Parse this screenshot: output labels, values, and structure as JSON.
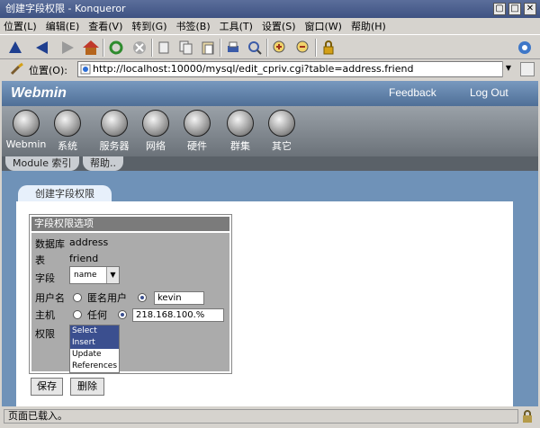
{
  "window": {
    "title": "创建字段权限 - Konqueror",
    "controls": [
      "▢",
      "□",
      "✕"
    ]
  },
  "menubar": [
    "位置(L)",
    "编辑(E)",
    "查看(V)",
    "转到(G)",
    "书签(B)",
    "工具(T)",
    "设置(S)",
    "窗口(W)",
    "帮助(H)"
  ],
  "location": {
    "label": "位置(O):",
    "url": "http://localhost:10000/mysql/edit_cpriv.cgi?table=address.friend"
  },
  "webmin": {
    "logo": "Webmin",
    "feedback": "Feedback",
    "logout": "Log Out",
    "nav": [
      "Webmin",
      "系统",
      "服务器",
      "网络",
      "硬件",
      "群集",
      "其它"
    ],
    "subtabs": [
      "Module 索引",
      "帮助.."
    ],
    "page_tab": "创建字段权限"
  },
  "form": {
    "panel_title": "字段权限选项",
    "db_label": "数据库",
    "db_value": "address",
    "table_label": "表",
    "table_value": "friend",
    "field_label": "字段",
    "field_value": "name",
    "user_label": "用户名",
    "user_anon": "匿名用户",
    "user_value": "kevin",
    "host_label": "主机",
    "host_any": "任何",
    "host_value": "218.168.100.%",
    "perm_label": "权限",
    "perms": [
      "Select",
      "Insert",
      "Update",
      "References"
    ],
    "save_label": "保存",
    "delete_label": "删除"
  },
  "status": {
    "text": "页面已载入。"
  },
  "colors": {
    "titlebar": "#4a5f8f",
    "webmin_blue": "#6f92b8",
    "select_highlight": "#3b4f8f"
  }
}
